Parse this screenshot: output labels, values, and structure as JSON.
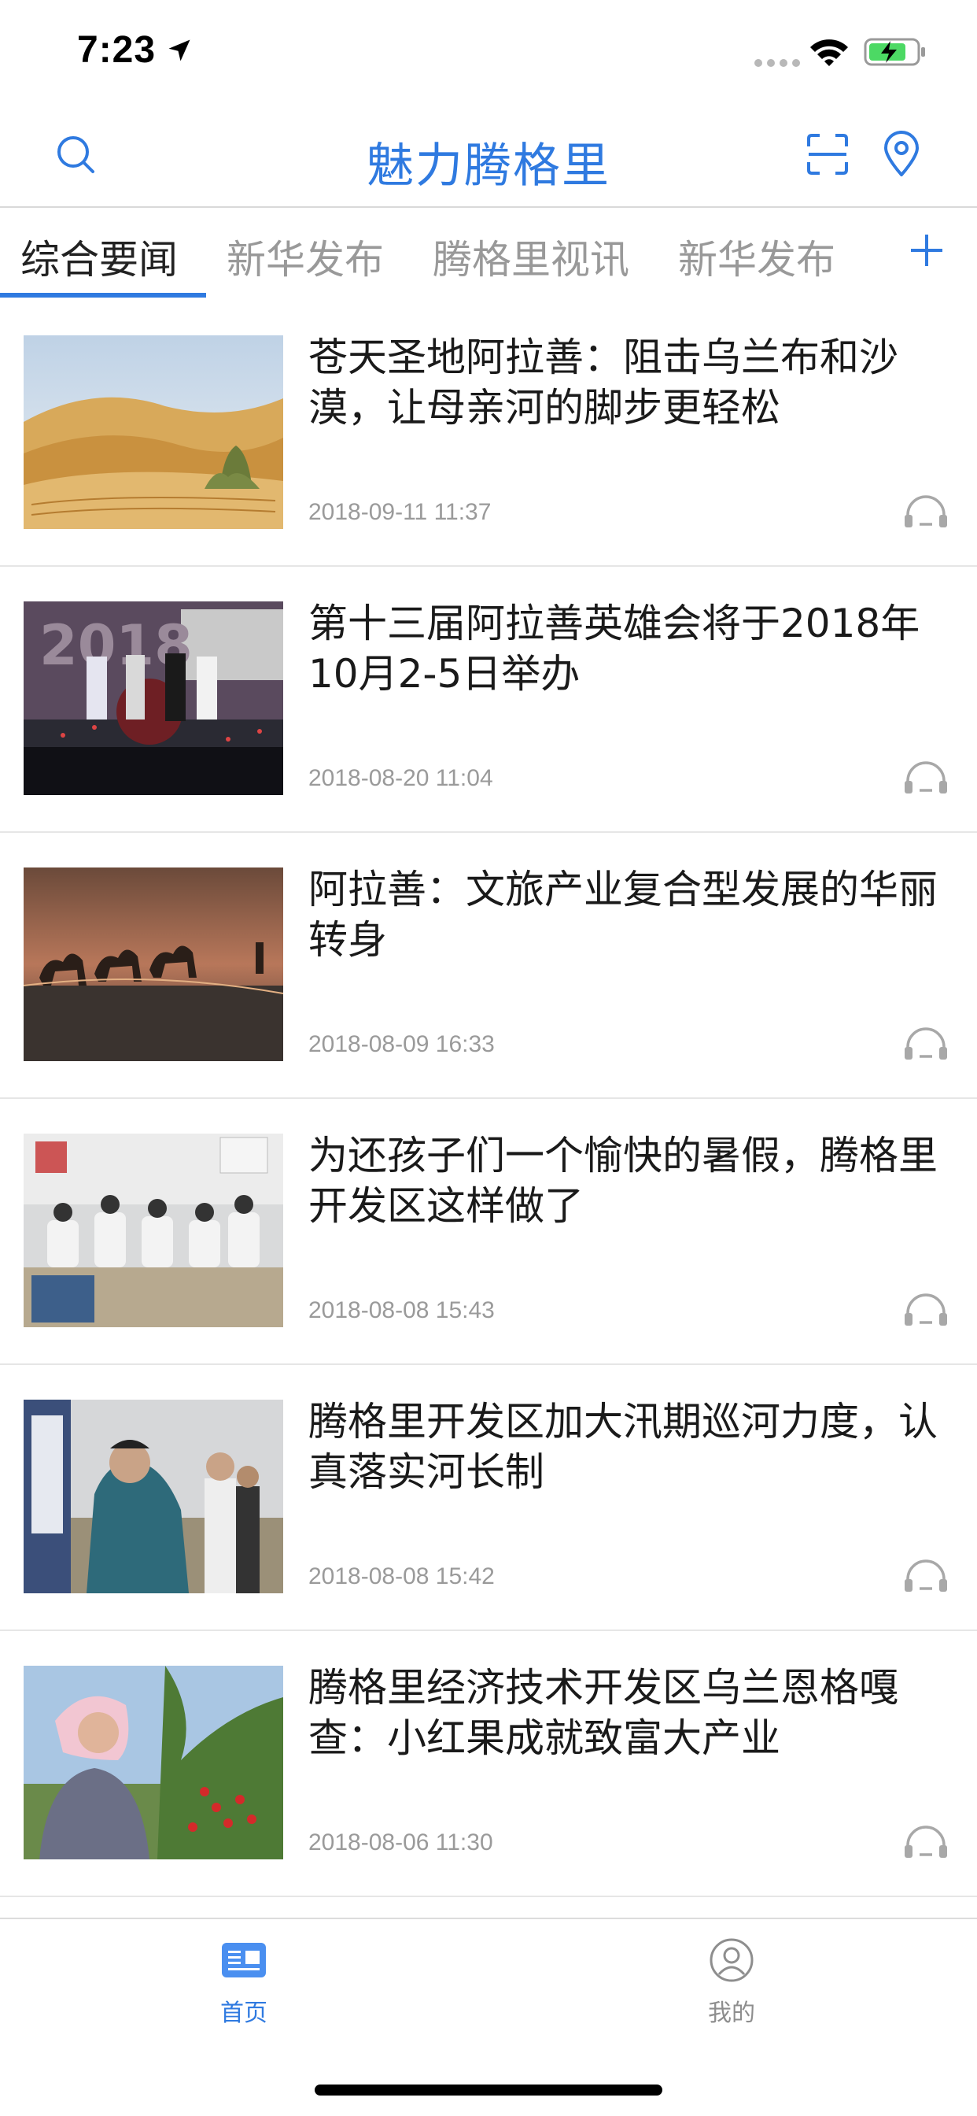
{
  "status_bar": {
    "time": "7:23"
  },
  "header": {
    "title": "魅力腾格里",
    "icons": [
      "search-icon",
      "scan-icon",
      "location-pin-icon"
    ],
    "accent_color": "#2f7ae0"
  },
  "tabs": {
    "items": [
      {
        "label": "综合要闻",
        "active": true
      },
      {
        "label": "新华发布",
        "active": false
      },
      {
        "label": "腾格里视讯",
        "active": false
      },
      {
        "label": "新华发布",
        "active": false
      }
    ],
    "add_icon": "plus-icon"
  },
  "articles": [
    {
      "title": "苍天圣地阿拉善：阻击乌兰布和沙漠，让母亲河的脚步更轻松",
      "time": "2018-09-11 11:37",
      "image": "desert-dunes"
    },
    {
      "title": "第十三届阿拉善英雄会将于2018年10月2-5日举办",
      "time": "2018-08-20 11:04",
      "image": "stage-event"
    },
    {
      "title": "阿拉善：文旅产业复合型发展的华丽转身",
      "time": "2018-08-09 16:33",
      "image": "camel-caravan"
    },
    {
      "title": "为还孩子们一个愉快的暑假，腾格里开发区这样做了",
      "time": "2018-08-08 15:43",
      "image": "classroom"
    },
    {
      "title": "腾格里开发区加大汛期巡河力度，认真落实河长制",
      "time": "2018-08-08 15:42",
      "image": "river-inspection"
    },
    {
      "title": "腾格里经济技术开发区乌兰恩格嘎查：小红果成就致富大产业",
      "time": "2018-08-06 11:30",
      "image": "goji-picking"
    }
  ],
  "tabbar": {
    "items": [
      {
        "label": "首页",
        "icon": "news-icon",
        "active": true
      },
      {
        "label": "我的",
        "icon": "user-icon",
        "active": false
      }
    ]
  }
}
